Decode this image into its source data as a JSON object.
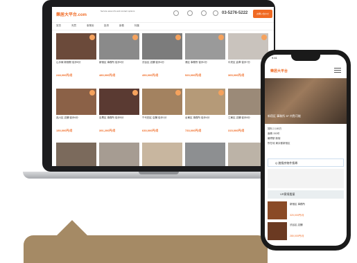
{
  "site": {
    "logo": "樂居大平台.com",
    "header_note": "Service area info and contact options",
    "phone": "03-5276-5222",
    "cta": "お問い合わせ"
  },
  "nav": [
    "賃貸",
    "売買",
    "事業用",
    "投資",
    "新着",
    "特集"
  ],
  "listings": [
    {
      "title": "山手線 新宿駅 徒歩5分",
      "price": "248,000円/月"
    },
    {
      "title": "新宿区 事務所 徒歩3分",
      "price": "480,000円/月"
    },
    {
      "title": "渋谷区 店舗 徒歩4分",
      "price": "450,000円/月"
    },
    {
      "title": "港区 事務所 徒歩2分",
      "price": "520,000円/月"
    },
    {
      "title": "中央区 倉庫 徒歩7分",
      "price": "365,000円/月"
    },
    {
      "title": "品川区 店舗 徒歩6分",
      "price": "150,000円/月"
    },
    {
      "title": "目黒区 事務所 徒歩5分",
      "price": "391,200円/月"
    },
    {
      "title": "千代田区 店舗 徒歩1分",
      "price": "630,000円/月"
    },
    {
      "title": "台東区 事務所 徒歩4分",
      "price": "733,000円/月"
    },
    {
      "title": "江東区 店舗 徒歩8分",
      "price": "315,000円/月"
    }
  ],
  "phone": {
    "time": "9:41",
    "logo": "樂居大平台",
    "hero_title": "新宿区 事務所 3F 内覧可能",
    "info": [
      "賃料 2,180万",
      "面積 152坪",
      "最寄駅 新宿",
      "所在地 東京都新宿区"
    ],
    "search_label": "Q 諸搜房物件搜尋",
    "vr_label": "VR實境看屋",
    "list": [
      {
        "title": "新宿区 事務所",
        "price": "320,000円/月"
      },
      {
        "title": "渋谷区 店舗",
        "price": "280,000円/月"
      }
    ]
  },
  "colors": {
    "brand": "#f06a23",
    "bubble": "#a58a65"
  }
}
